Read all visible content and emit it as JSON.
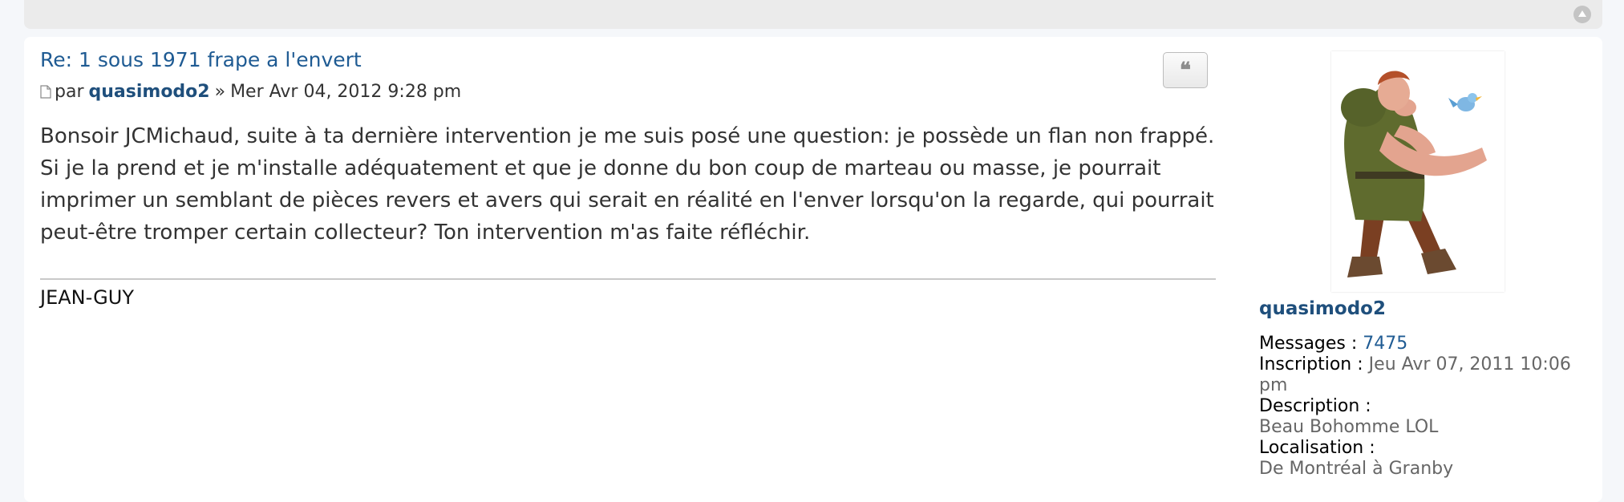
{
  "post": {
    "title": "Re: 1 sous 1971 frape a l'envert",
    "meta": {
      "by_label": "par",
      "author": "quasimodo2",
      "separator": "»",
      "date": "Mer Avr 04, 2012 9:28 pm"
    },
    "quote_button_glyph": "❝",
    "body_lines": [
      "Bonsoir JCMichaud, suite à ta dernière intervention je me suis posé une question: je possède un flan non frappé.",
      "Si je la prend et je m'installe adéquatement et que je donne du bon coup de marteau ou masse, je pourrait",
      "imprimer un semblant de pièces revers et avers qui serait en réalité en l'enver lorsqu'on la regarde, qui pourrait",
      "peut-être tromper certain collecteur? Ton intervention m'as faite réfléchir."
    ],
    "signature": "JEAN-GUY"
  },
  "profile": {
    "username": "quasimodo2",
    "messages_label": "Messages :",
    "messages_value": "7475",
    "joined_label": "Inscription :",
    "joined_value": "Jeu Avr 07, 2011 10:06 pm",
    "description_label": "Description :",
    "description_value": "Beau Bohomme LOL",
    "location_label": "Localisation :",
    "location_value": "De Montréal à Granby"
  },
  "icons": {
    "post": "post-icon",
    "quote": "quote-icon",
    "back_to_top": "arrow-up-icon",
    "avatar": "quasimodo-avatar"
  },
  "colors": {
    "link": "#1f5b93",
    "author": "#1f4f7c",
    "text": "#333333",
    "muted": "#666666",
    "page_bg": "#f5f7fa",
    "panel_bg": "#ffffff"
  }
}
